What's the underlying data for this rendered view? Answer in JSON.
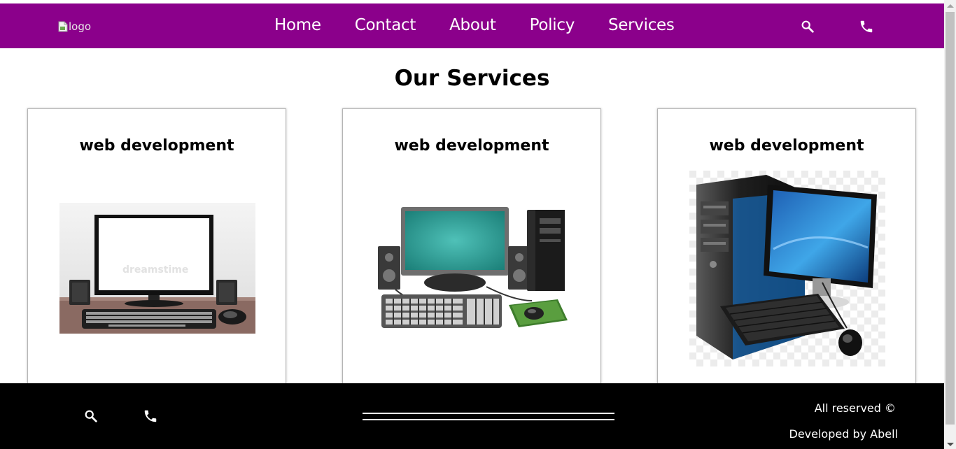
{
  "header": {
    "logo_alt": "logo",
    "nav": [
      "Home",
      "Contact",
      "About",
      "Policy",
      "Services"
    ],
    "icons": [
      "search-icon",
      "phone-icon"
    ],
    "background_color": "#8b008b"
  },
  "main": {
    "heading": "Our Services",
    "cards": [
      {
        "title": "web development",
        "image": "desktop-monitor-on-desk-illustration"
      },
      {
        "title": "web development",
        "image": "desktop-computer-set-illustration"
      },
      {
        "title": "web development",
        "image": "desktop-tower-and-monitor-illustration"
      }
    ]
  },
  "footer": {
    "icons": [
      "search-icon",
      "phone-icon"
    ],
    "reserved": "All reserved ©",
    "developed": "Developed by Abell",
    "background_color": "#000000"
  }
}
